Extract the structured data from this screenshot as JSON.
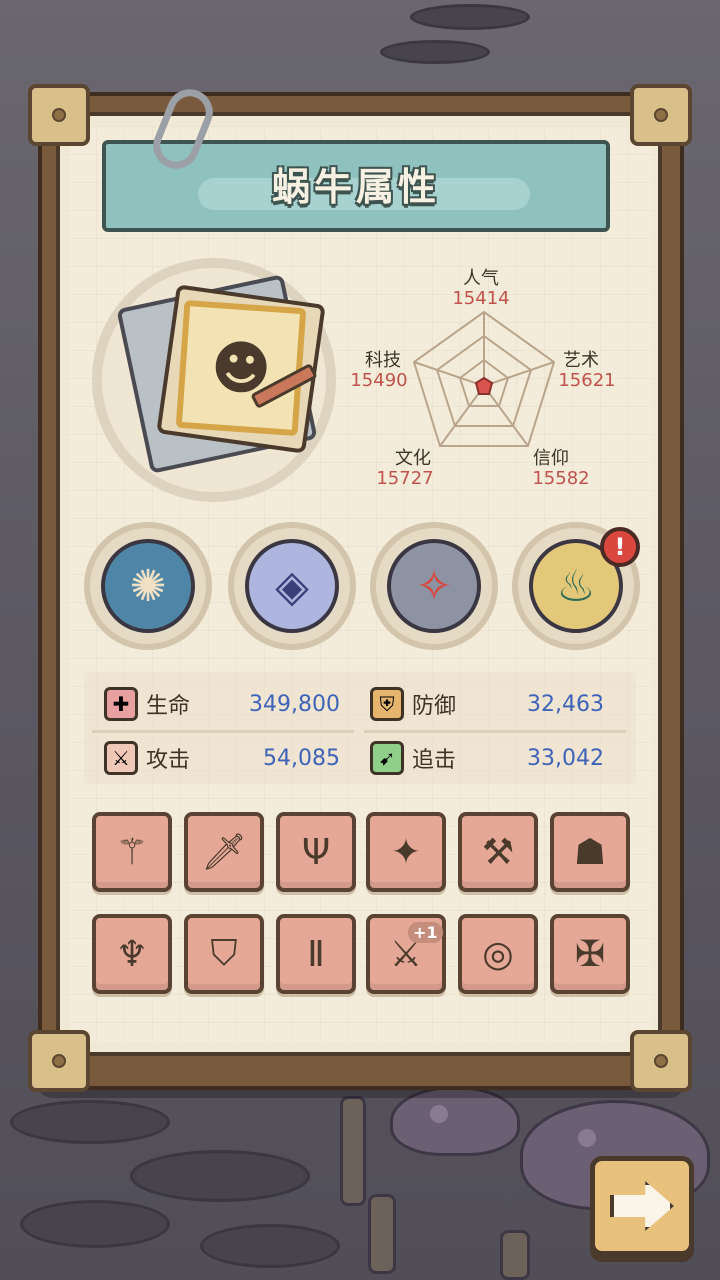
{
  "title": "蜗牛属性",
  "attributes": [
    {
      "key": "popularity",
      "label": "人气",
      "value": "15414"
    },
    {
      "key": "art",
      "label": "艺术",
      "value": "15621"
    },
    {
      "key": "faith",
      "label": "信仰",
      "value": "15582"
    },
    {
      "key": "culture",
      "label": "文化",
      "value": "15727"
    },
    {
      "key": "tech",
      "label": "科技",
      "value": "15490"
    }
  ],
  "relics": [
    {
      "icon": "spiked-shell-relic-icon"
    },
    {
      "icon": "crystal-orb-relic-icon"
    },
    {
      "icon": "compass-relic-icon"
    },
    {
      "icon": "golden-flame-relic-icon",
      "alert": "!"
    }
  ],
  "stats": {
    "hp": {
      "label": "生命",
      "value": "349,800"
    },
    "defense": {
      "label": "防御",
      "value": "32,463"
    },
    "attack": {
      "label": "攻击",
      "value": "54,085"
    },
    "chase": {
      "label": "追击",
      "value": "33,042"
    }
  },
  "equipment": [
    {
      "icon": "scepter-icon"
    },
    {
      "icon": "sword-icon"
    },
    {
      "icon": "slingshot-icon"
    },
    {
      "icon": "blaster-icon"
    },
    {
      "icon": "hammer-icon"
    },
    {
      "icon": "armor-icon"
    },
    {
      "icon": "trident-icon"
    },
    {
      "icon": "shield-icon"
    },
    {
      "icon": "greaves-icon"
    },
    {
      "icon": "dagger-icon",
      "badge": "+1"
    },
    {
      "icon": "ring-icon"
    },
    {
      "icon": "crossbow-icon"
    }
  ],
  "colors": {
    "accent_value": "#c2524d",
    "stat_value": "#3f63b8",
    "slot_bg": "#e5a897",
    "banner": "#8fc1bf"
  }
}
